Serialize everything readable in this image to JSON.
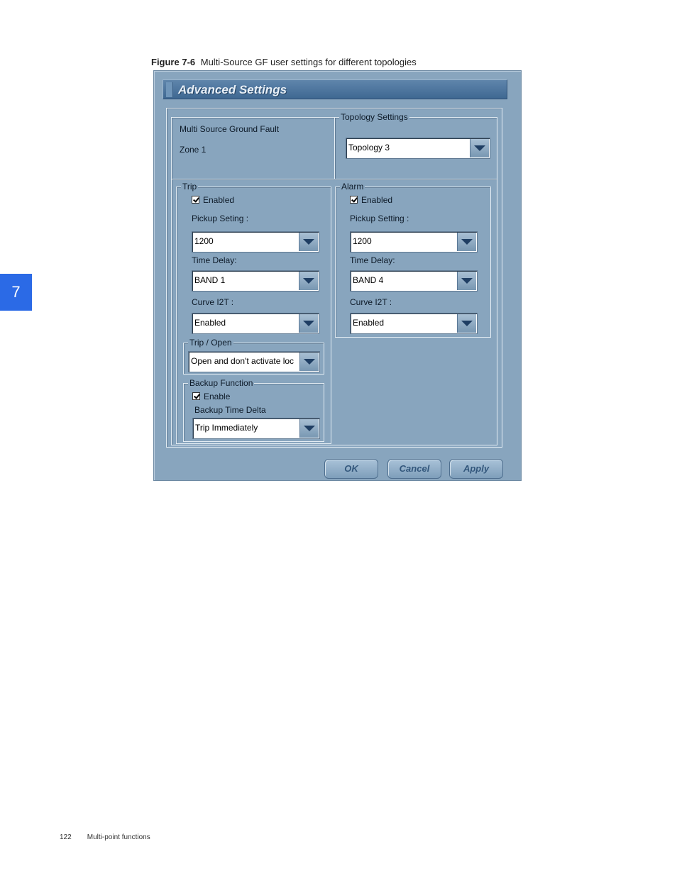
{
  "caption": {
    "figure_number": "Figure 7-6",
    "text": "Multi-Source GF user settings for different topologies"
  },
  "chapter_tab": "7",
  "footer": {
    "page_number": "122",
    "section": "Multi-point functions"
  },
  "dialog": {
    "title": "Advanced Settings",
    "info": {
      "line1": "Multi Source Ground Fault",
      "line2": "Zone 1"
    },
    "topology": {
      "legend": "Topology Settings",
      "value": "Topology 3"
    },
    "trip": {
      "legend": "Trip",
      "enabled_label": "Enabled",
      "pickup_label": "Pickup Seting :",
      "pickup_value": "1200",
      "delay_label": "Time Delay:",
      "delay_value": "BAND 1",
      "curve_label": "Curve I2T :",
      "curve_value": "Enabled",
      "trip_open_legend": "Trip / Open",
      "trip_open_value": "Open and  don't activate loc",
      "backup_legend": "Backup Function",
      "backup_enable_label": "Enable",
      "backup_delta_label": "Backup Time Delta",
      "backup_delta_value": "Trip Immediately"
    },
    "alarm": {
      "legend": "Alarm",
      "enabled_label": "Enabled",
      "pickup_label": "Pickup Setting :",
      "pickup_value": "1200",
      "delay_label": "Time Delay:",
      "delay_value": "BAND 4",
      "curve_label": "Curve I2T :",
      "curve_value": "Enabled"
    },
    "buttons": {
      "ok": "OK",
      "cancel": "Cancel",
      "apply": "Apply"
    }
  }
}
